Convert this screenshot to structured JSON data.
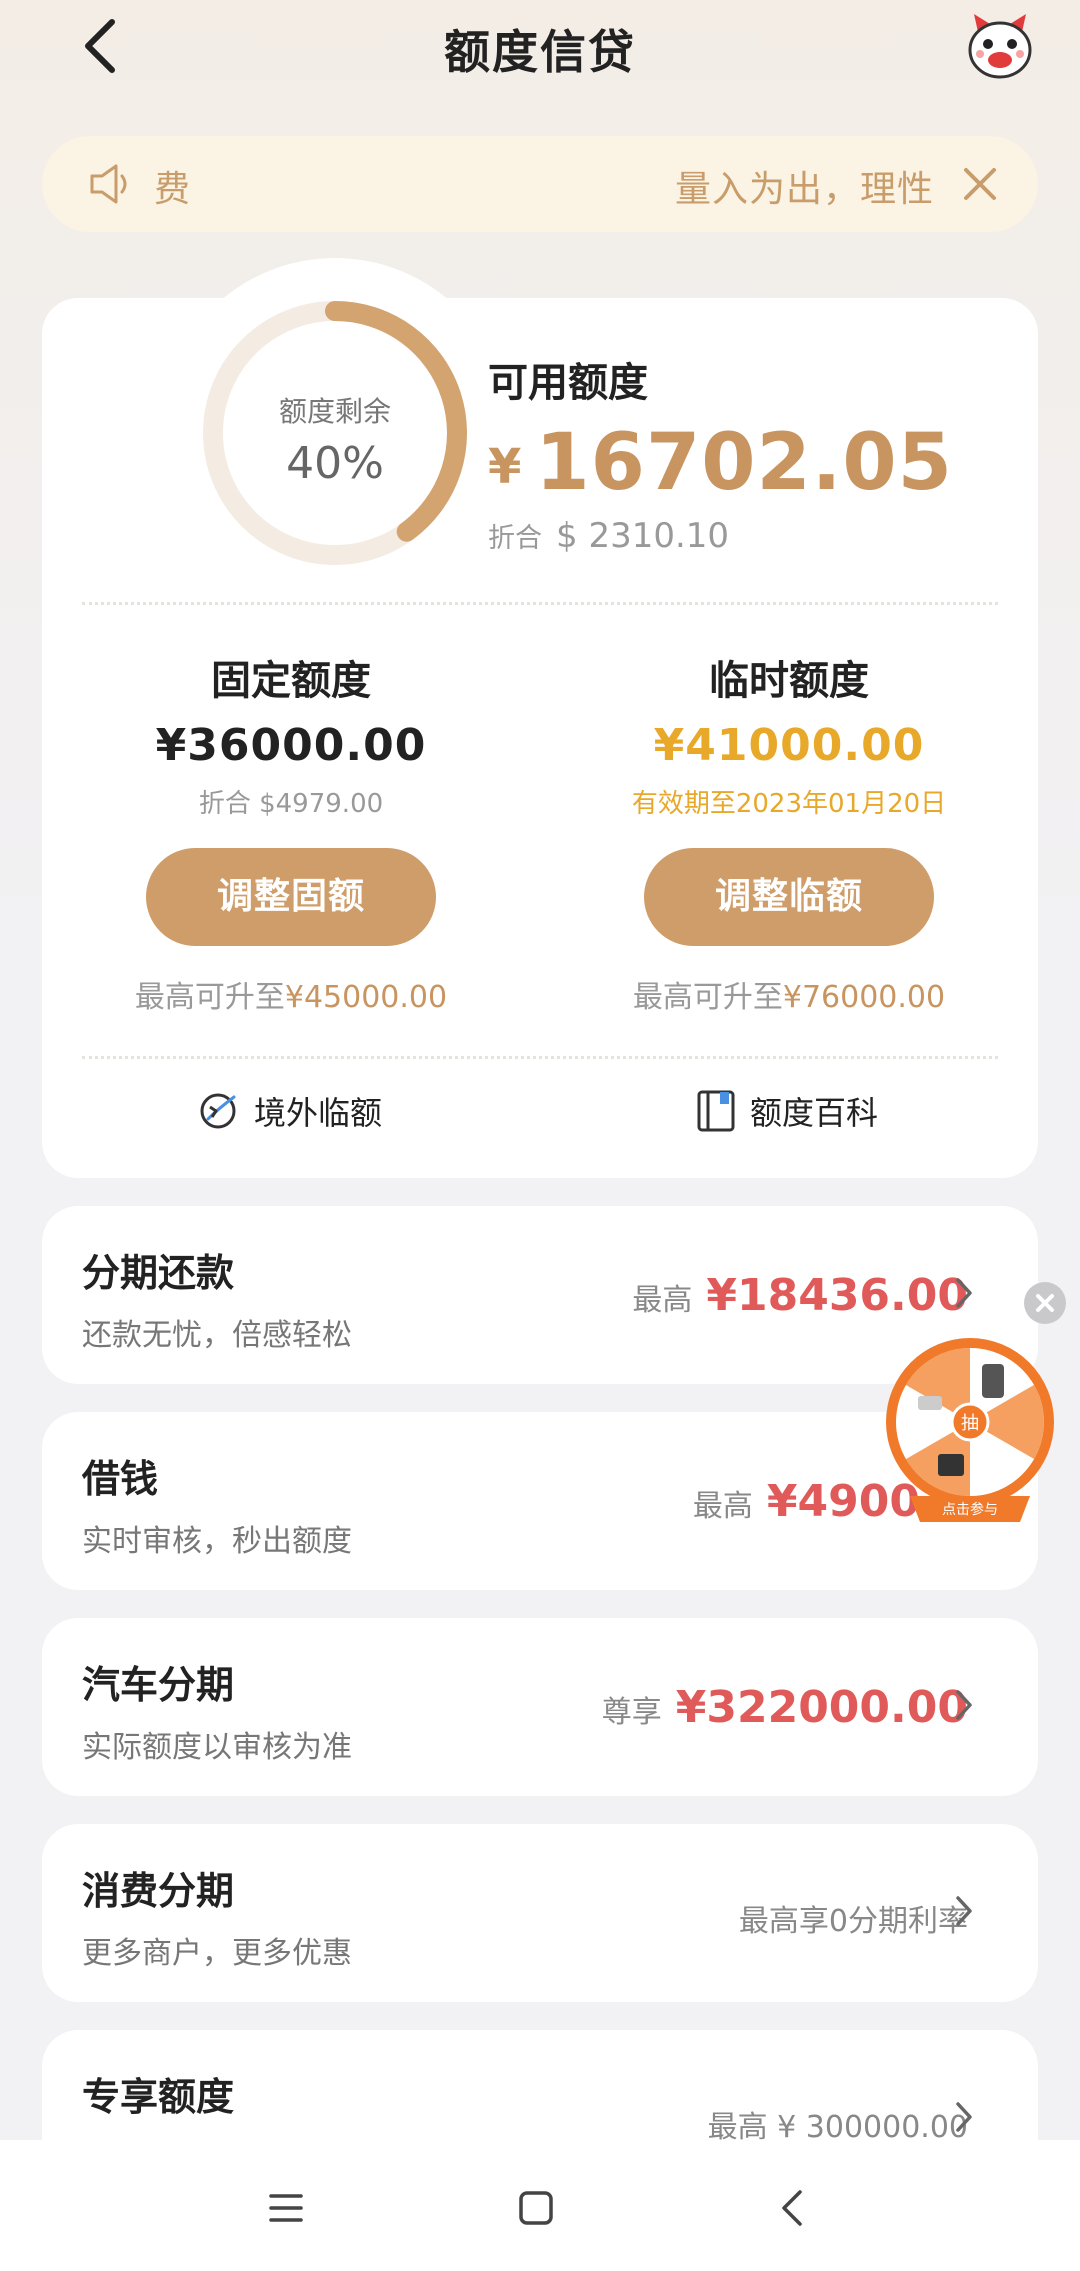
{
  "header": {
    "title": "额度信贷"
  },
  "notice": {
    "left_text": "费",
    "right_text": "量入为出，理性"
  },
  "credit": {
    "ring_label": "额度剩余",
    "ring_percent_text": "40%",
    "ring_fraction": 0.4,
    "available_title": "可用额度",
    "currency": "¥",
    "available_amount": "16702.05",
    "usd_label": "折合",
    "usd_amount": "$ 2310.10"
  },
  "fixed": {
    "title": "固定额度",
    "amount": "¥36000.00",
    "sub": "折合 $4979.00",
    "button": "调整固额",
    "max_label": "最高可升至",
    "max_value": "¥45000.00"
  },
  "temp": {
    "title": "临时额度",
    "amount": "¥41000.00",
    "sub": "有效期至2023年01月20日",
    "button": "调整临额",
    "max_label": "最高可升至",
    "max_value": "¥76000.00"
  },
  "quick_links": {
    "overseas": "境外临额",
    "wiki": "额度百科"
  },
  "rows": [
    {
      "title": "分期还款",
      "sub": "还款无忧，倍感轻松",
      "prefix": "最高",
      "value": "¥18436.00"
    },
    {
      "title": "借钱",
      "sub": "实时审核，秒出额度",
      "prefix": "最高",
      "value": "¥4900"
    },
    {
      "title": "汽车分期",
      "sub": "实际额度以审核为准",
      "prefix": "尊享",
      "value": "¥322000.00"
    },
    {
      "title": "消费分期",
      "sub": "更多商户，更多优惠",
      "prefix": "",
      "value": "最高享0分期利率"
    },
    {
      "title": "专享额度",
      "sub": "",
      "prefix": "",
      "value": "最高 ¥ 300000.00"
    }
  ],
  "floating": {
    "wheel_center": "抽",
    "wheel_caption": "点击参与"
  },
  "colors": {
    "accent": "#cf9d69",
    "gold": "#e8a82a",
    "red": "#e05a5a"
  },
  "icons": [
    "back-icon",
    "mascot-icon",
    "speaker-icon",
    "close-icon",
    "globe-icon",
    "book-icon",
    "chevron-right-icon",
    "menu-icon",
    "home-icon",
    "nav-back-icon"
  ]
}
